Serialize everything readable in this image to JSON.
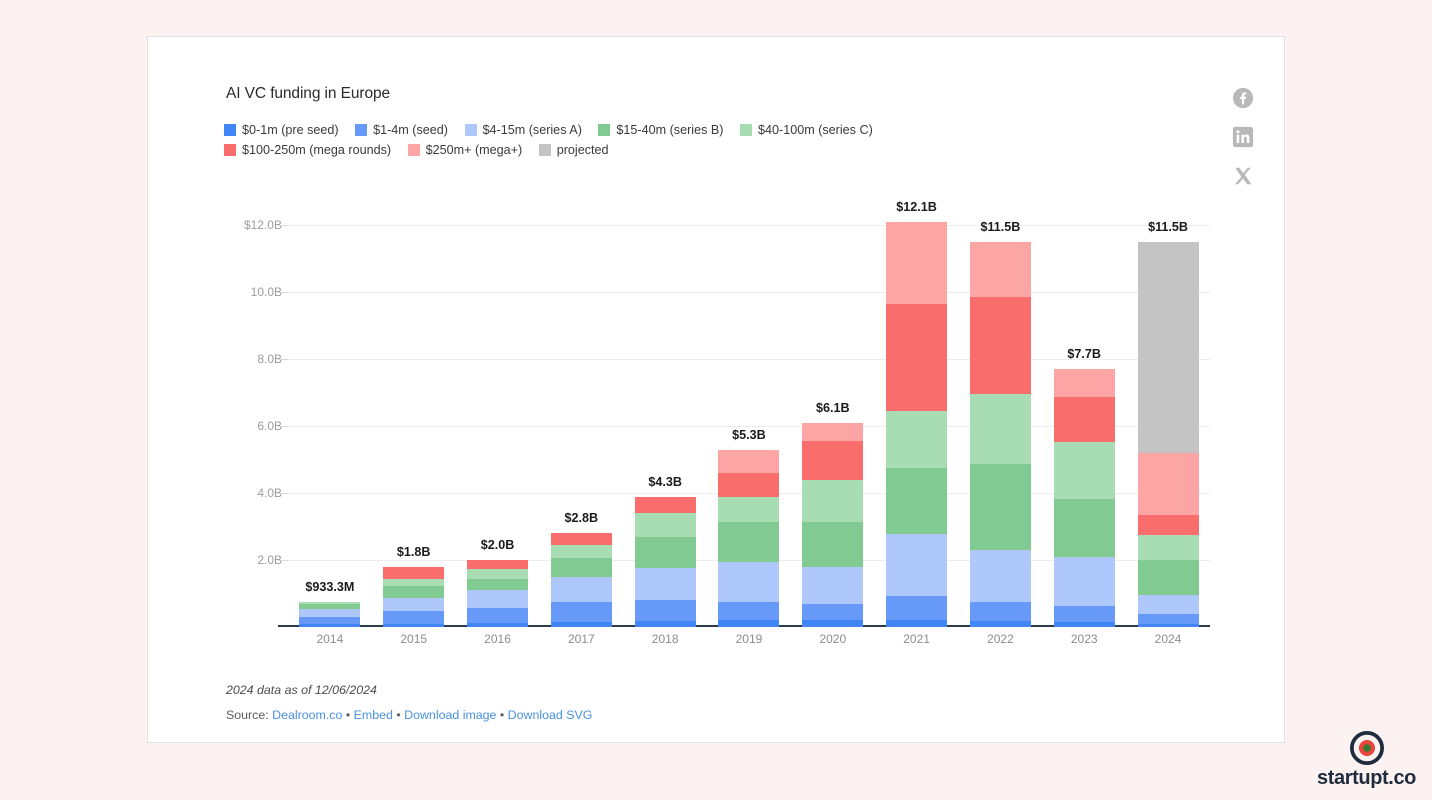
{
  "chart": {
    "title": "AI VC funding in Europe",
    "note": "2024 data as of 12/06/2024",
    "source_prefix": "Source:",
    "links": [
      {
        "label": "Dealroom.co"
      },
      {
        "label": "Embed"
      },
      {
        "label": "Download image"
      },
      {
        "label": "Download SVG"
      }
    ],
    "separator": "•"
  },
  "socials": [
    {
      "name": "facebook-icon"
    },
    {
      "name": "linkedin-icon"
    },
    {
      "name": "x-icon"
    }
  ],
  "brand": {
    "name": "startupt.co"
  },
  "chart_data": {
    "type": "bar",
    "stacked": true,
    "title": "AI VC funding in Europe",
    "xlabel": "",
    "ylabel": "",
    "ylim": [
      0,
      13.0
    ],
    "grid": true,
    "legend_position": "top",
    "ytick_labels": [
      "$12.0B",
      "10.0B",
      "8.0B",
      "6.0B",
      "4.0B",
      "2.0B"
    ],
    "yticks": [
      12.0,
      10.0,
      8.0,
      6.0,
      4.0,
      2.0
    ],
    "categories": [
      "2014",
      "2015",
      "2016",
      "2017",
      "2018",
      "2019",
      "2020",
      "2021",
      "2022",
      "2023",
      "2024"
    ],
    "totals_labels": [
      "$933.3M",
      "$1.8B",
      "$2.0B",
      "$2.8B",
      "$4.3B",
      "$5.3B",
      "$6.1B",
      "$12.1B",
      "$11.5B",
      "$7.7B",
      "$11.5B"
    ],
    "totals": [
      0.9333,
      1.8,
      2.0,
      2.8,
      4.3,
      5.3,
      6.1,
      12.1,
      11.5,
      7.7,
      11.5
    ],
    "series": [
      {
        "name": "$0-1m (pre seed)",
        "color": "#4285f4",
        "values": [
          0.08,
          0.1,
          0.12,
          0.15,
          0.18,
          0.2,
          0.2,
          0.22,
          0.18,
          0.14,
          0.1
        ]
      },
      {
        "name": "$1-4m (seed)",
        "color": "#6699f8",
        "values": [
          0.22,
          0.38,
          0.45,
          0.6,
          0.62,
          0.55,
          0.5,
          0.7,
          0.58,
          0.5,
          0.3
        ]
      },
      {
        "name": "$4-15m (series A)",
        "color": "#aec8fb",
        "values": [
          0.23,
          0.4,
          0.55,
          0.75,
          0.95,
          1.2,
          1.1,
          1.85,
          1.55,
          1.45,
          0.55
        ]
      },
      {
        "name": "$15-40m (series B)",
        "color": "#81cb92",
        "values": [
          0.16,
          0.35,
          0.33,
          0.55,
          0.95,
          1.2,
          1.35,
          1.98,
          2.55,
          1.75,
          1.05
        ]
      },
      {
        "name": "$40-100m (series C)",
        "color": "#a8ddb3",
        "values": [
          0.06,
          0.22,
          0.3,
          0.4,
          0.72,
          0.75,
          1.25,
          1.72,
          2.1,
          1.7,
          0.75
        ]
      },
      {
        "name": "$100-250m (mega rounds)",
        "color": "#f96d6d",
        "values": [
          0.0,
          0.35,
          0.25,
          0.35,
          0.48,
          0.7,
          1.15,
          3.18,
          2.9,
          1.35,
          0.6
        ]
      },
      {
        "name": "$250m+ (mega+)",
        "color": "#fba5a5",
        "values": [
          0.0,
          0.0,
          0.0,
          0.0,
          0.0,
          0.7,
          0.55,
          2.45,
          1.64,
          0.81,
          1.85
        ]
      },
      {
        "name": "projected",
        "color": "#c4c4c4",
        "values": [
          0.0,
          0.0,
          0.0,
          0.0,
          0.0,
          0.0,
          0.0,
          0.0,
          0.0,
          0.0,
          6.3
        ]
      }
    ]
  }
}
